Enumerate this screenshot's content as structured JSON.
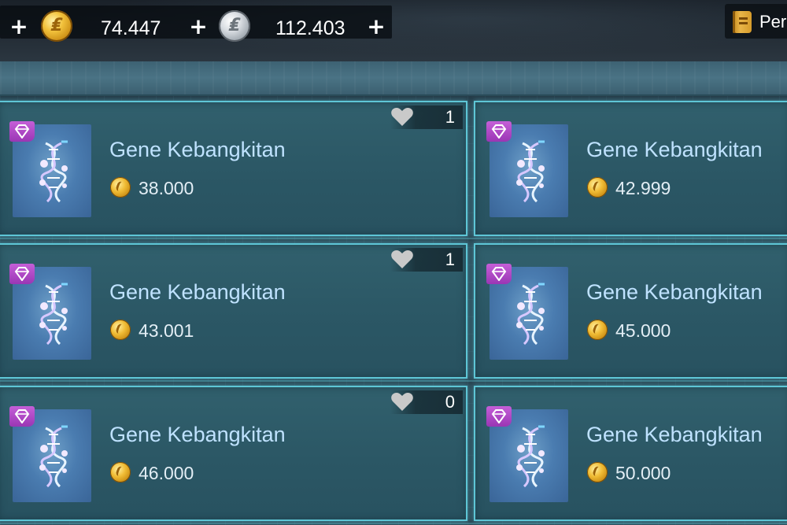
{
  "topbar": {
    "gold_amount": "74.447",
    "silver_amount": "112.403",
    "plus_symbol": "+",
    "right_button_label": "Per"
  },
  "items": [
    {
      "name": "Gene Kebangkitan",
      "price": "38.000",
      "likes": "1"
    },
    {
      "name": "Gene Kebangkitan",
      "price": "42.999"
    },
    {
      "name": "Gene Kebangkitan",
      "price": "43.001",
      "likes": "1"
    },
    {
      "name": "Gene Kebangkitan",
      "price": "45.000"
    },
    {
      "name": "Gene Kebangkitan",
      "price": "46.000",
      "likes": "0"
    },
    {
      "name": "Gene Kebangkitan",
      "price": "50.000"
    }
  ],
  "colors": {
    "card_border": "#5ec6d6",
    "item_name": "#bfe2ff",
    "rarity_badge": "#b04cc8",
    "gold_coin": "#f0bc35",
    "silver_coin": "#c9ced3"
  },
  "icons": {
    "gold_coin": "gold-coin-icon",
    "silver_coin": "silver-coin-icon",
    "like": "heart-icon",
    "rarity": "diamond-badge-icon",
    "item": "dna-helix-icon",
    "menu": "book-icon"
  }
}
